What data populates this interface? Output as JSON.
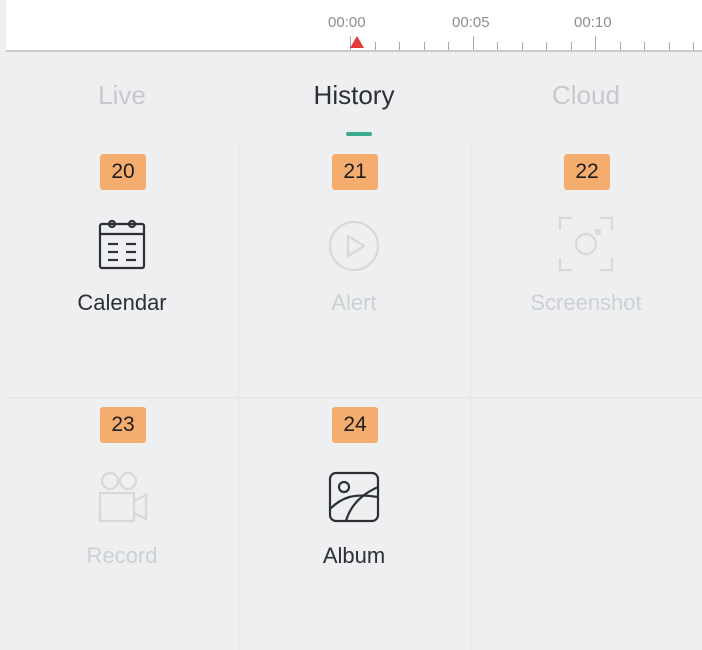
{
  "timeline": {
    "labels": [
      "00:00",
      "00:05",
      "00:10"
    ]
  },
  "tabs": [
    {
      "label": "Live",
      "active": false
    },
    {
      "label": "History",
      "active": true
    },
    {
      "label": "Cloud",
      "active": false
    }
  ],
  "colors": {
    "accent": "#3aaa8e",
    "badge": "#f4ad6e",
    "marker": "#e53935",
    "text_active": "#2c2f33",
    "text_disabled": "#cdd0d3"
  },
  "grid": [
    {
      "badge": "20",
      "label": "Calendar",
      "icon": "calendar-icon",
      "enabled": true
    },
    {
      "badge": "21",
      "label": "Alert",
      "icon": "play-icon",
      "enabled": false
    },
    {
      "badge": "22",
      "label": "Screenshot",
      "icon": "camera-icon",
      "enabled": false
    },
    {
      "badge": "23",
      "label": "Record",
      "icon": "video-record-icon",
      "enabled": false
    },
    {
      "badge": "24",
      "label": "Album",
      "icon": "album-icon",
      "enabled": true
    }
  ]
}
